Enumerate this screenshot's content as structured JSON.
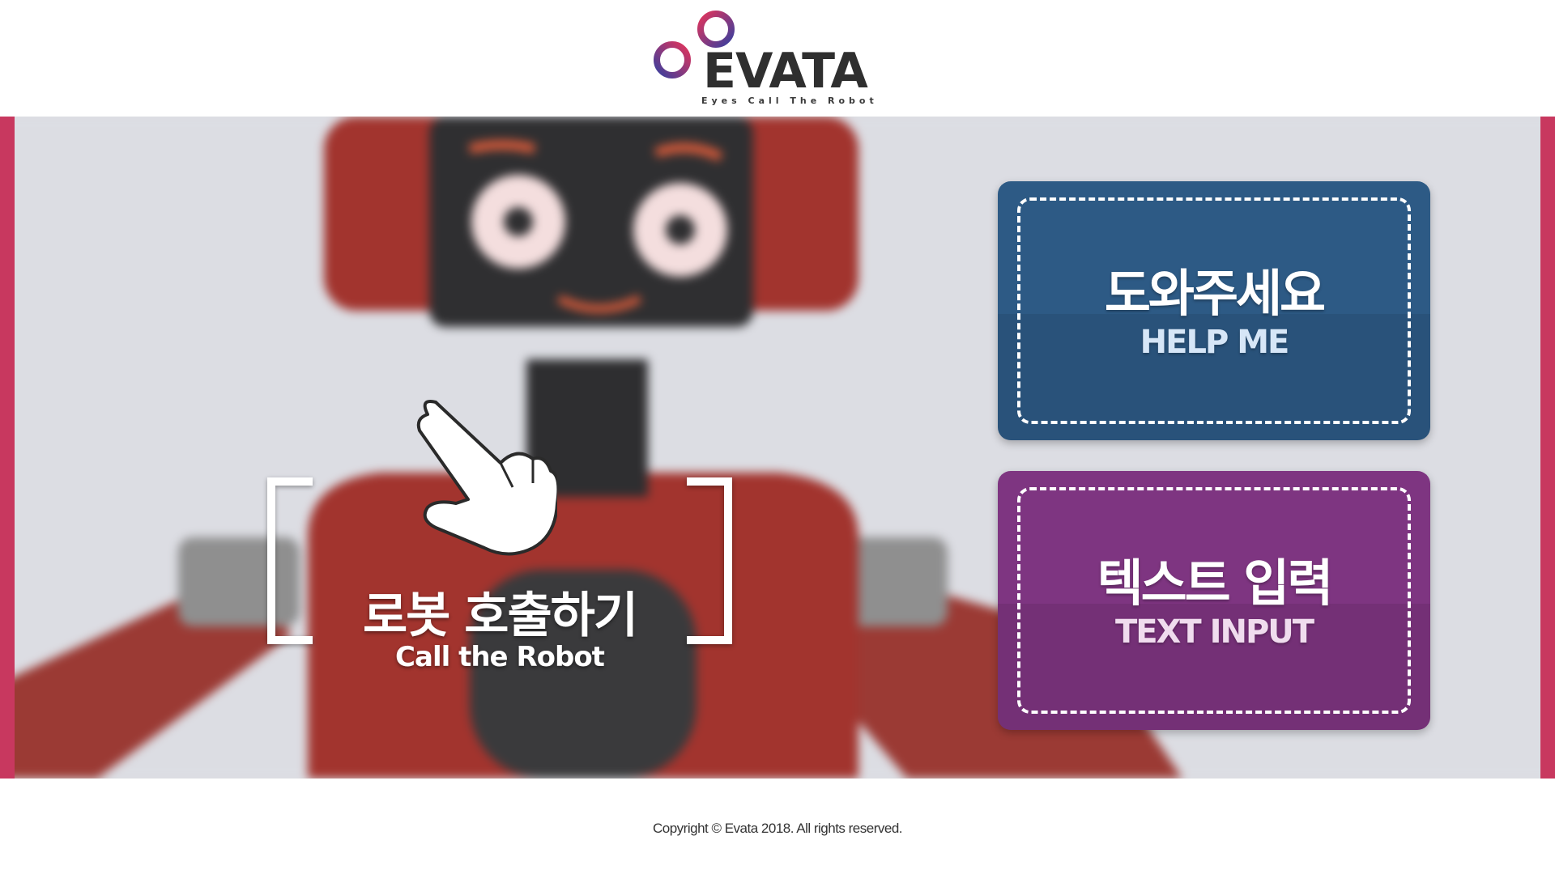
{
  "header": {
    "logo_text": "EVATA",
    "logo_tagline": "Eyes Call The Robot"
  },
  "hero": {
    "call_robot": {
      "label_ko": "로봇 호출하기",
      "label_en": "Call the Robot",
      "icon": "pointing-hand-icon"
    },
    "help_button": {
      "label_ko": "도와주세요",
      "label_en": "HELP ME",
      "color": "#2d5a85"
    },
    "text_input_button": {
      "label_ko": "텍스트 입력",
      "label_en": "TEXT INPUT",
      "color": "#7e3581"
    },
    "accent_color": "#c8385f"
  },
  "footer": {
    "copyright": "Copyright © Evata 2018. All rights reserved."
  }
}
